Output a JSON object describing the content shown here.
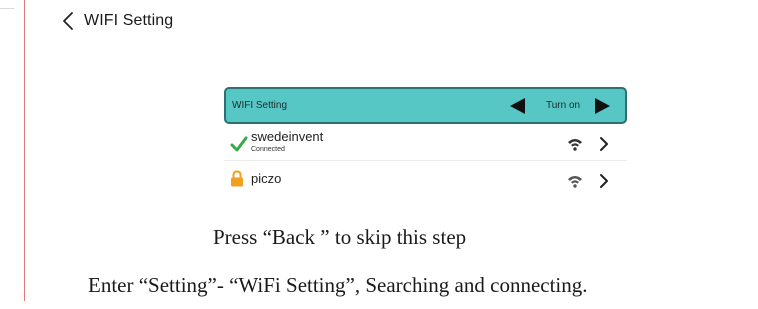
{
  "header": {
    "back_icon": "chevron-left-icon",
    "title": "WIFI Setting"
  },
  "wifi_setting_bar": {
    "label": "WIFI Setting",
    "value": "Turn on",
    "prev_icon": "triangle-left-icon",
    "next_icon": "triangle-right-icon",
    "background_color": "#57c7c6",
    "border_color": "#2e6f71"
  },
  "networks": [
    {
      "name": "swedeinvent",
      "status": "Connected",
      "status_icon": "checkmark-icon",
      "signal_icon": "wifi-signal-icon",
      "chevron_icon": "chevron-right-icon",
      "accent": "#3aa84a"
    },
    {
      "name": "piczo",
      "status": "",
      "status_icon": "lock-icon",
      "signal_icon": "wifi-signal-icon",
      "chevron_icon": "chevron-right-icon",
      "accent": "#f0a020"
    }
  ],
  "instructions": {
    "skip": "Press “Back ” to skip this step",
    "enter": "Enter “Setting”- “WiFi Setting”, Searching and connecting."
  }
}
